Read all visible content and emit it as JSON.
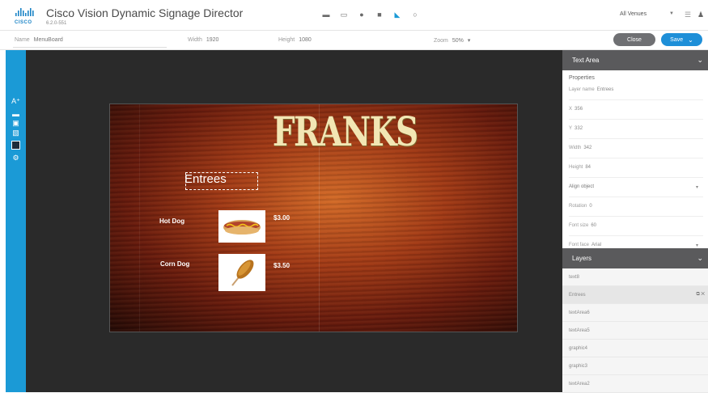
{
  "header": {
    "logo_text": "CISCO",
    "app_title": "Cisco Vision Dynamic Signage Director",
    "version": "6.2.0-551",
    "venue": "All Venues",
    "icons": [
      "folder-icon",
      "monitor-icon",
      "settings-icon",
      "grid-icon",
      "design-icon",
      "gear-icon"
    ]
  },
  "props_bar": {
    "name_label": "Name",
    "name_placeholder": "MenuBoard",
    "width_label": "Width",
    "width_value": "1920",
    "height_label": "Height",
    "height_value": "1080",
    "zoom_label": "Zoom",
    "zoom_value": "50%",
    "close_label": "Close",
    "save_label": "Save"
  },
  "canvas": {
    "brand": "FRANKS",
    "section": "Entrees",
    "items": [
      {
        "label": "Hot Dog",
        "price": "$3.00",
        "image": "hot-dog"
      },
      {
        "label": "Corn Dog",
        "price": "$3.50",
        "image": "corn-dog"
      }
    ]
  },
  "right_panel": {
    "text_area_title": "Text Area",
    "properties_title": "Properties",
    "props": {
      "layer_name_label": "Layer name",
      "layer_name_value": "Entrees",
      "x_label": "X",
      "x_value": "356",
      "y_label": "Y",
      "y_value": "332",
      "width_label": "Width",
      "width_value": "342",
      "height_label": "Height",
      "height_value": "84",
      "align_label": "Align object",
      "rotation_label": "Rotation",
      "rotation_value": "0",
      "font_size_label": "Font size",
      "font_size_value": "60",
      "font_face_label": "Font face",
      "font_face_value": "Arial"
    },
    "layers_title": "Layers",
    "layers": [
      "text8",
      "Entrees",
      "textArea6",
      "textArea5",
      "graphic4",
      "graphic3",
      "textArea2"
    ]
  },
  "colors": {
    "accent": "#1b9ad6",
    "save": "#1e8fd8",
    "close": "#6f7073",
    "panel_head": "#5a5a5c",
    "workspace": "#2a2a2a"
  }
}
